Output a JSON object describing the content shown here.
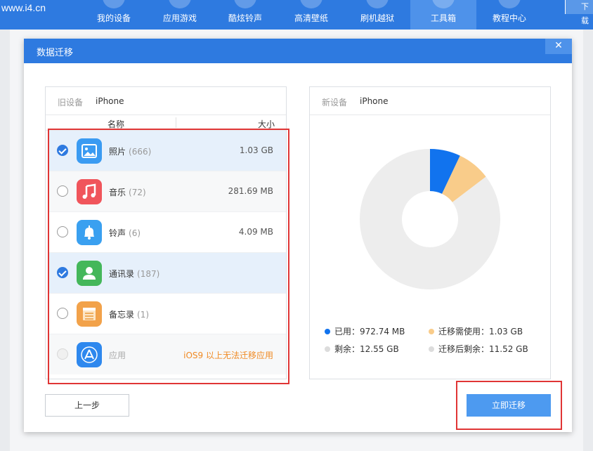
{
  "app": {
    "site": "www.i4.cn",
    "nav": [
      {
        "label": "我的设备",
        "active": false
      },
      {
        "label": "应用游戏",
        "active": false
      },
      {
        "label": "酷炫铃声",
        "active": false
      },
      {
        "label": "高清壁纸",
        "active": false
      },
      {
        "label": "刷机越狱",
        "active": false
      },
      {
        "label": "工具箱",
        "active": true
      },
      {
        "label": "教程中心",
        "active": false
      }
    ],
    "download_label": "下载"
  },
  "dialog": {
    "title": "数据迁移",
    "close_glyph": "✕",
    "old_device": {
      "tag": "旧设备",
      "name": "iPhone",
      "col_name": "名称",
      "col_size": "大小",
      "items": [
        {
          "label": "照片",
          "count": "(666)",
          "size": "1.03 GB",
          "checked": true,
          "icon": "photos-icon",
          "color": "#3a9bf2"
        },
        {
          "label": "音乐",
          "count": "(72)",
          "size": "281.69 MB",
          "checked": false,
          "icon": "music-icon",
          "color": "#f0555b"
        },
        {
          "label": "铃声",
          "count": "(6)",
          "size": "4.09 MB",
          "checked": false,
          "icon": "bell-icon",
          "color": "#3aa0f0"
        },
        {
          "label": "通讯录",
          "count": "(187)",
          "size": "",
          "checked": true,
          "icon": "contacts-icon",
          "color": "#44b75a"
        },
        {
          "label": "备忘录",
          "count": "(1)",
          "size": "",
          "checked": false,
          "icon": "notes-icon",
          "color": "#f2a24a"
        },
        {
          "label": "应用",
          "count": "",
          "size": "iOS9 以上无法迁移应用",
          "checked": false,
          "disabled": true,
          "icon": "app-store-icon",
          "color": "#2e88ee"
        }
      ]
    },
    "new_device": {
      "tag": "新设备",
      "name": "iPhone",
      "legend": [
        {
          "label": "已用：972.74 MB",
          "color": "#1173ee"
        },
        {
          "label": "迁移需使用：1.03 GB",
          "color": "#f9cc8a"
        },
        {
          "label": "剩余：12.55 GB",
          "color": "#dcdcdc"
        },
        {
          "label": "迁移后剩余：11.52 GB",
          "color": "#dcdcdc"
        }
      ]
    },
    "prev_button": "上一步",
    "migrate_button": "立即迁移"
  },
  "chart_data": {
    "type": "pie",
    "donut": true,
    "categories": [
      "已用",
      "迁移需使用",
      "剩余"
    ],
    "values": [
      972.74,
      1054.72,
      11796.48
    ],
    "units": "MB",
    "colors": [
      "#1173ee",
      "#f9cc8a",
      "#ededed"
    ],
    "title": "",
    "xlabel": "",
    "ylabel": ""
  }
}
